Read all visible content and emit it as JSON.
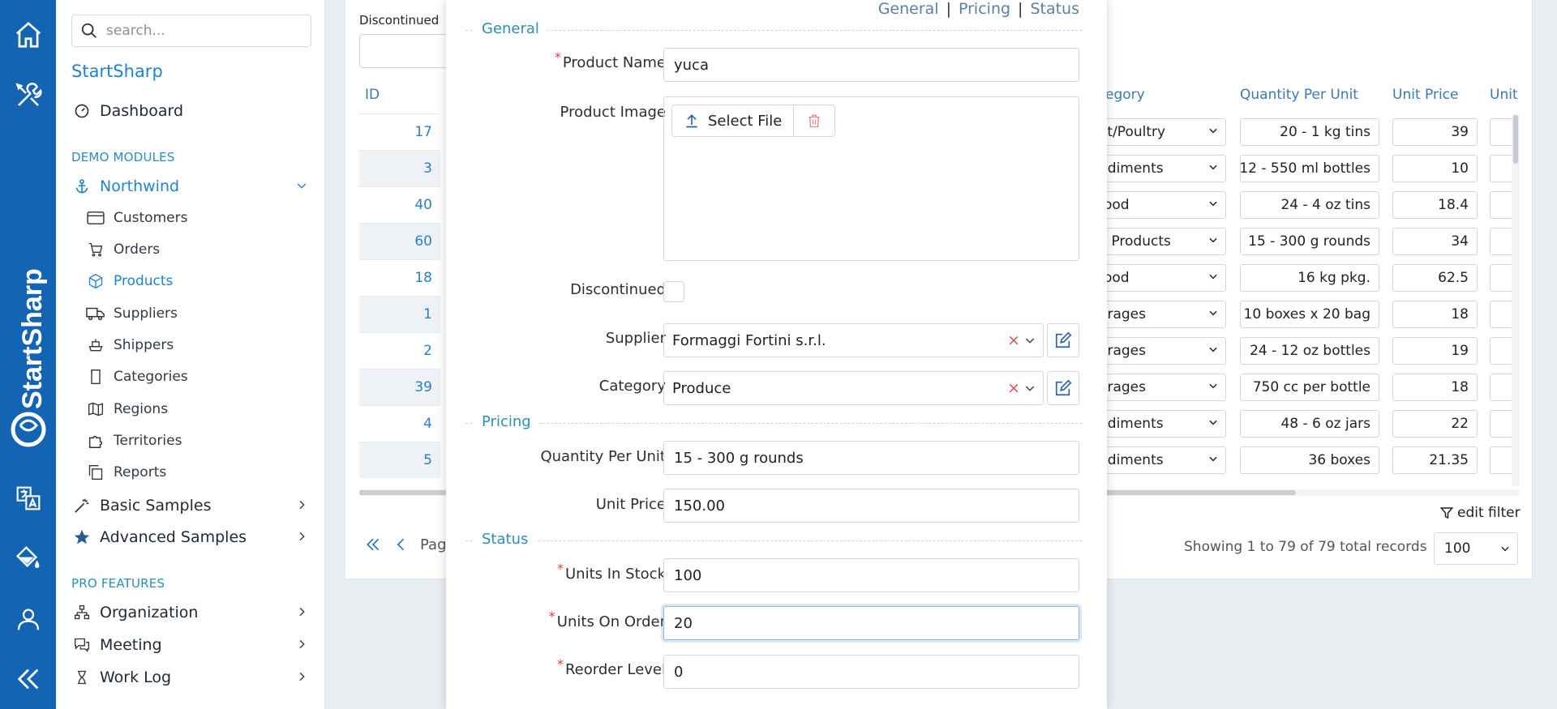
{
  "sidebar": {
    "search_placeholder": "search...",
    "brand": "StartSharp",
    "rail_brand": "StartSharp",
    "dashboard": "Dashboard",
    "demo_modules_header": "DEMO MODULES",
    "northwind": "Northwind",
    "sub_items": [
      "Customers",
      "Orders",
      "Products",
      "Suppliers",
      "Shippers",
      "Categories",
      "Regions",
      "Territories",
      "Reports"
    ],
    "active_sub_item": "Products",
    "basic_samples": "Basic Samples",
    "advanced_samples": "Advanced Samples",
    "pro_features_header": "PRO FEATURES",
    "pro_items": [
      "Organization",
      "Meeting",
      "Work Log"
    ]
  },
  "grid": {
    "discontinued_label": "Discontinued",
    "columns": {
      "id": "ID",
      "category": "egory",
      "quantity": "Quantity Per Unit",
      "price": "Unit Price",
      "unit": "Unit"
    },
    "rows": [
      {
        "id": "17",
        "category": "at/Poultry",
        "quantity": "20 - 1 kg tins",
        "price": "39"
      },
      {
        "id": "3",
        "category": "ndiments",
        "quantity": "12 - 550 ml bottles",
        "price": "10"
      },
      {
        "id": "40",
        "category": "food",
        "quantity": "24 - 4 oz tins",
        "price": "18.4"
      },
      {
        "id": "60",
        "category": "y Products",
        "quantity": "15 - 300 g rounds",
        "price": "34"
      },
      {
        "id": "18",
        "category": "food",
        "quantity": "16 kg pkg.",
        "price": "62.5"
      },
      {
        "id": "1",
        "category": "erages",
        "quantity": "10 boxes x 20 bag",
        "price": "18"
      },
      {
        "id": "2",
        "category": "erages",
        "quantity": "24 - 12 oz bottles",
        "price": "19"
      },
      {
        "id": "39",
        "category": "erages",
        "quantity": "750 cc per bottle",
        "price": "18"
      },
      {
        "id": "4",
        "category": "ndiments",
        "quantity": "48 - 6 oz jars",
        "price": "22"
      },
      {
        "id": "5",
        "category": "ndiments",
        "quantity": "36 boxes",
        "price": "21.35"
      }
    ],
    "edit_filter": "edit filter",
    "page_label": "Pag",
    "status_text": "Showing 1 to 79 of 79 total records",
    "page_size": "100"
  },
  "dialog": {
    "tabs": [
      "General",
      "Pricing",
      "Status"
    ],
    "tab_separator": "|",
    "sections": {
      "general": "General",
      "pricing": "Pricing",
      "status": "Status"
    },
    "fields": {
      "product_name": {
        "label": "Product Name",
        "value": "yuca"
      },
      "product_image": {
        "label": "Product Image",
        "select_file": "Select File"
      },
      "discontinued": {
        "label": "Discontinued"
      },
      "supplier": {
        "label": "Supplier",
        "value": "Formaggi Fortini s.r.l."
      },
      "category": {
        "label": "Category",
        "value": "Produce"
      },
      "quantity_per_unit": {
        "label": "Quantity Per Unit",
        "value": "15 - 300 g rounds"
      },
      "unit_price": {
        "label": "Unit Price",
        "value": "150.00"
      },
      "units_in_stock": {
        "label": "Units In Stock",
        "value": "100"
      },
      "units_on_order": {
        "label": "Units On Order",
        "value": "20"
      },
      "reorder_level": {
        "label": "Reorder Level",
        "value": "0"
      }
    },
    "required_mark": "*",
    "clear_mark": "×"
  },
  "colors": {
    "rail": "#1464b4",
    "accent": "#2b8fb3",
    "link": "#2c7ec4",
    "danger": "#e23b3b"
  }
}
